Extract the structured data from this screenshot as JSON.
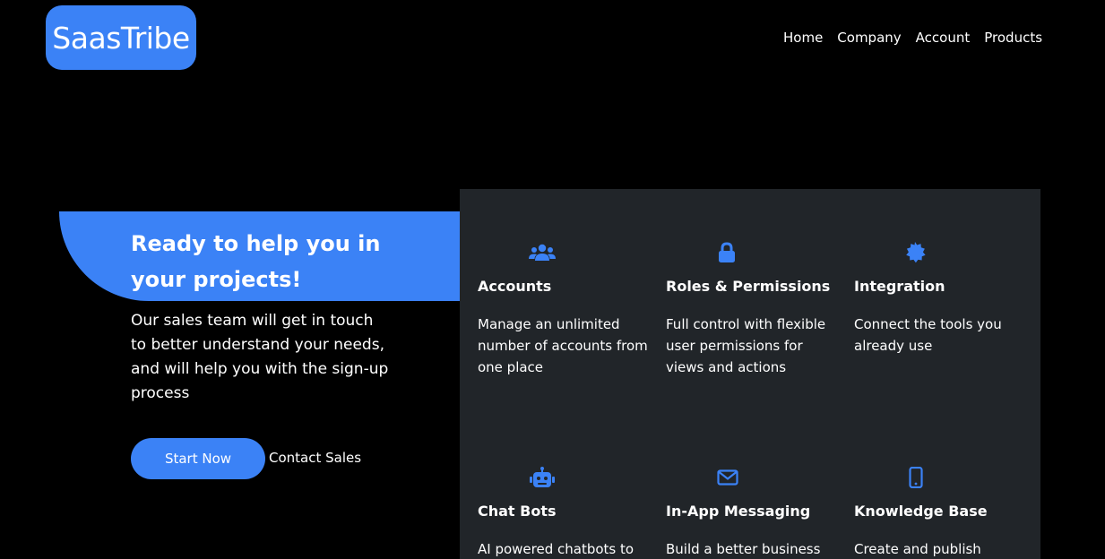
{
  "brand": {
    "name": "SaasTribe",
    "accent": "#3b82f6"
  },
  "nav": {
    "items": [
      {
        "label": "Home"
      },
      {
        "label": "Company"
      },
      {
        "label": "Account"
      },
      {
        "label": "Products"
      }
    ]
  },
  "hero": {
    "title": "Ready to help you in your projects!",
    "description": "Our sales team will get in touch to better understand your needs, and will help you with the sign-up process",
    "primary_cta": "Start Now",
    "secondary_cta": "Contact Sales"
  },
  "features": {
    "background": "#212529",
    "items": [
      {
        "icon": "users-icon",
        "title": "Accounts",
        "description": "Manage an unlimited number of accounts from one place"
      },
      {
        "icon": "lock-icon",
        "title": "Roles & Permissions",
        "description": "Full control with flexible user permissions for views and actions"
      },
      {
        "icon": "badge-icon",
        "title": "Integration",
        "description": "Connect the tools you already use"
      },
      {
        "icon": "robot-icon",
        "title": "Chat Bots",
        "description": "AI powered chatbots to"
      },
      {
        "icon": "envelope-icon",
        "title": "In-App Messaging",
        "description": "Build a better business"
      },
      {
        "icon": "phone-icon",
        "title": "Knowledge Base",
        "description": "Create and publish"
      }
    ]
  }
}
